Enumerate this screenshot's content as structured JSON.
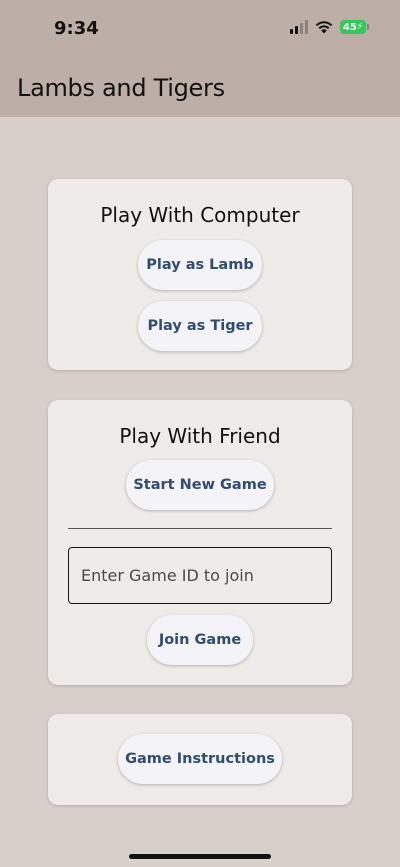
{
  "status_bar": {
    "time": "9:34",
    "battery": "45",
    "icons": [
      "cellular-signal-icon",
      "wifi-icon",
      "battery-charging-icon"
    ]
  },
  "app_bar": {
    "title": "Lambs and Tigers"
  },
  "computer_card": {
    "title": "Play With Computer",
    "lamb_button": "Play as Lamb",
    "tiger_button": "Play as Tiger"
  },
  "friend_card": {
    "title": "Play With Friend",
    "start_button": "Start New Game",
    "game_id_input": {
      "placeholder": "Enter Game ID to join",
      "value": ""
    },
    "join_button": "Join Game"
  },
  "instructions_card": {
    "button": "Game Instructions"
  },
  "colors": {
    "background": "#d9cfca",
    "app_bar": "#bdafa8",
    "card": "#efebe8",
    "button_text": "#2f4d72",
    "battery": "#34c759"
  }
}
